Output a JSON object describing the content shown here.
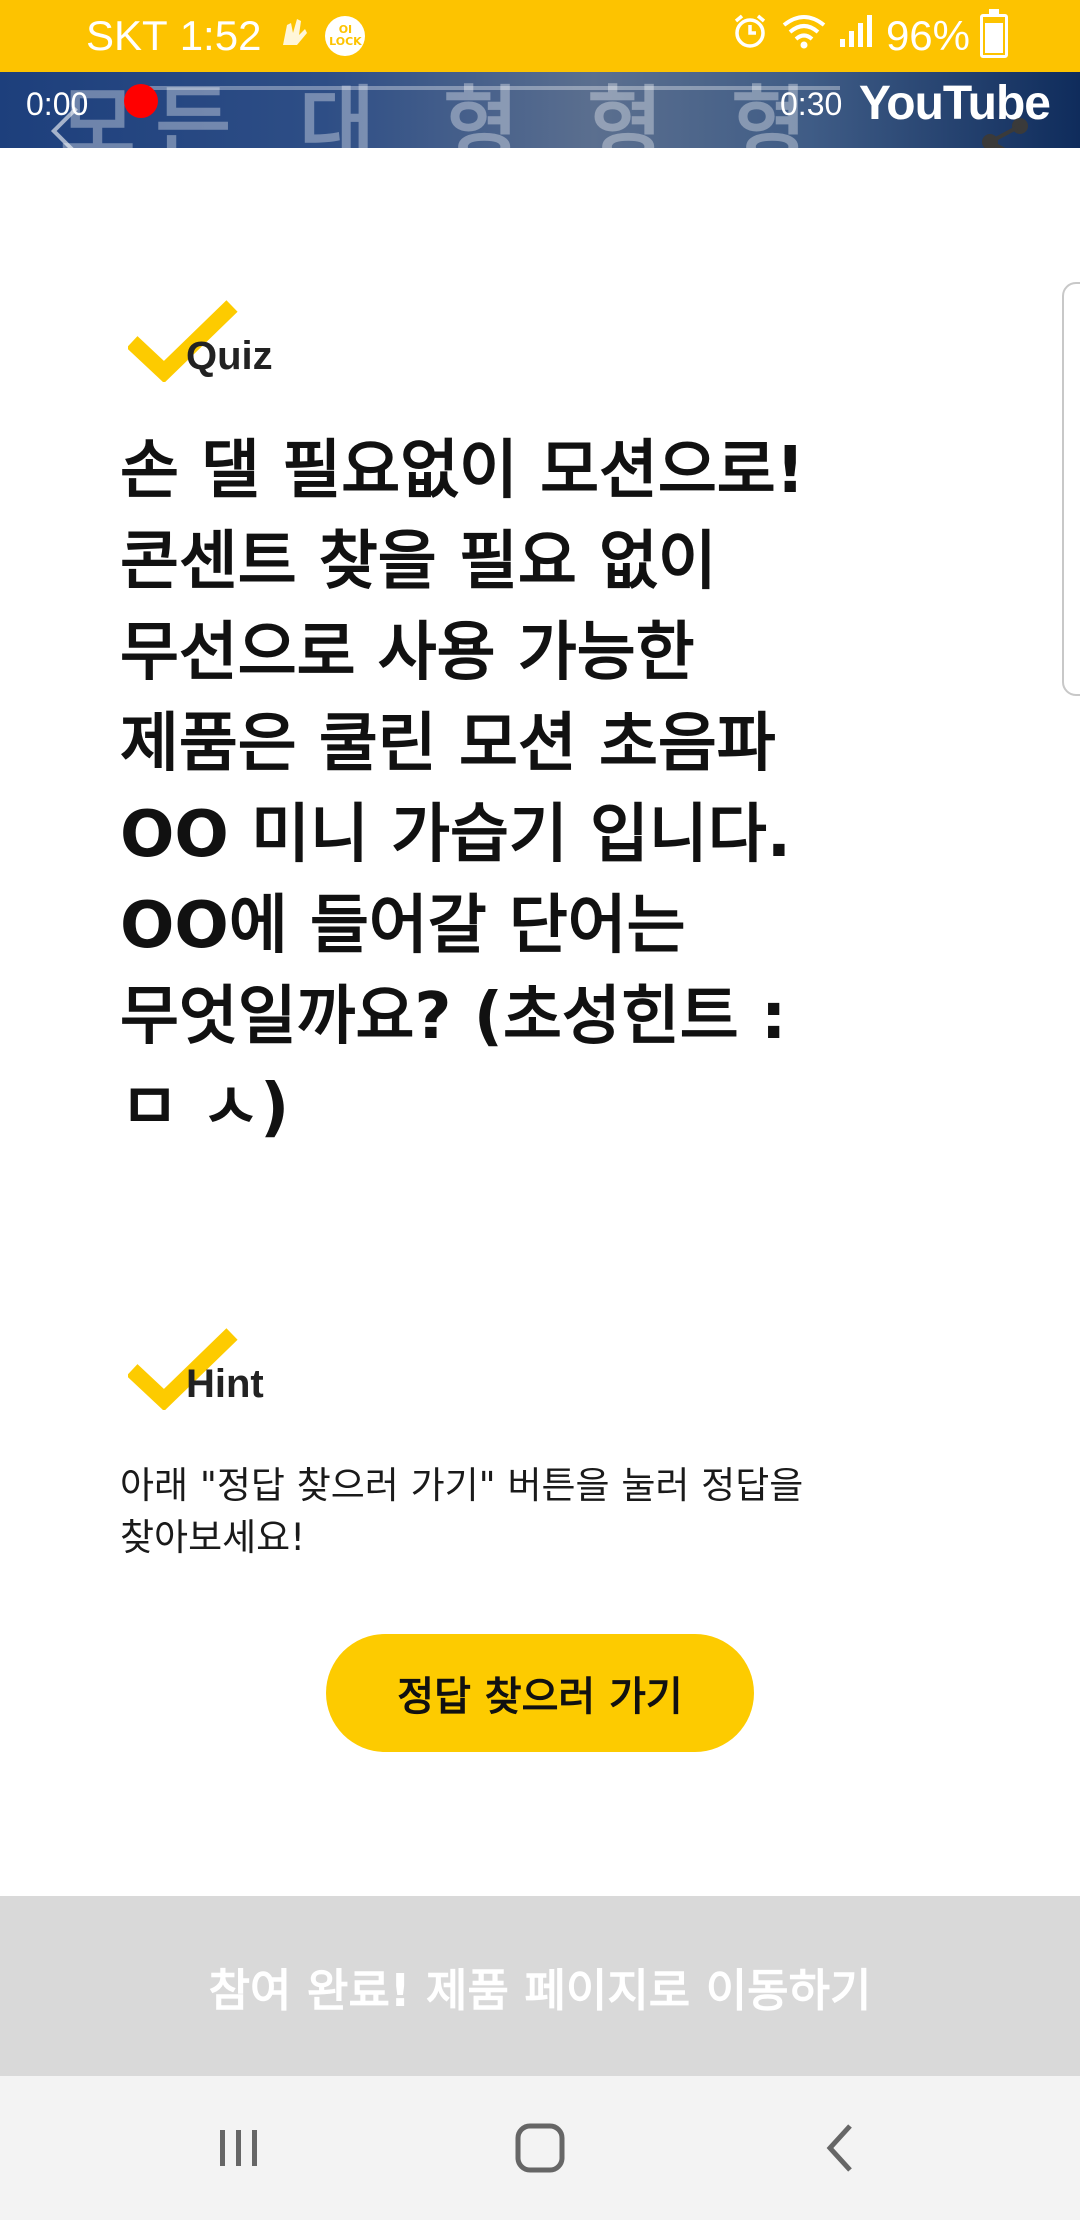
{
  "status_bar": {
    "carrier": "SKT",
    "time": "1:52",
    "lock_badge": "OI\nLOCK",
    "battery": "96%",
    "background_color": "#FDC300"
  },
  "video": {
    "time_current": "0:00",
    "time_total": "0:30",
    "brand": "YouTube",
    "progress": 0
  },
  "quiz": {
    "label": "Quiz",
    "question": "손 댈 필요없이 모션으로!\n콘센트 찾을 필요 없이\n무선으로 사용 가능한\n제품은 쿨린 모션 초음파\nOO 미니 가습기 입니다.\nOO에 들어갈 단어는\n무엇일까요? (초성힌트 :\n ㅁ ㅅ)"
  },
  "hint": {
    "label": "Hint",
    "text": "아래 \"정답 찾으러 가기\" 버튼을 눌러 정답을\n찾아보세요!",
    "button_label": "정답 찾으러 가기",
    "accent_color": "#FDCB00"
  },
  "footer": {
    "cta_label": "참여 완료! 제품 페이지로 이동하기"
  },
  "icons": {
    "check": "check-icon",
    "share": "share-icon",
    "back": "back-arrow-icon",
    "recents": "recent-apps-icon",
    "home": "home-icon",
    "nav_back": "back-icon"
  }
}
